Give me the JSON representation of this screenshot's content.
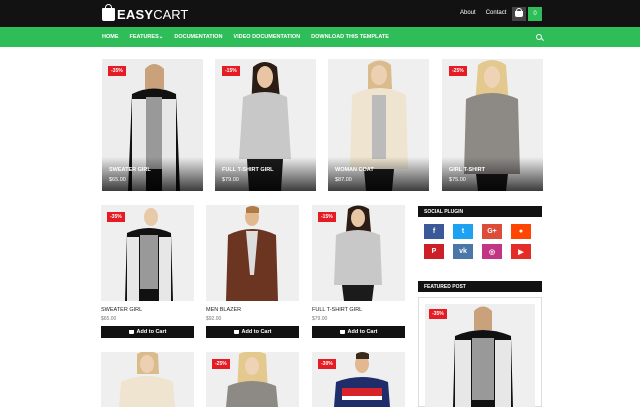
{
  "header": {
    "logo_bold": "EASY",
    "logo_rest": "CART",
    "links": [
      "About",
      "Contact"
    ],
    "cart_count": "0"
  },
  "nav": {
    "items": [
      "HOME",
      "FEATURES",
      "DOCUMENTATION",
      "VIDEO DOCUMENTATION",
      "DOWNLOAD THIS TEMPLATE"
    ],
    "features_caret": "⌄"
  },
  "featured": [
    {
      "name": "SWEATER GIRL",
      "price": "$65.00",
      "badge": "-35%"
    },
    {
      "name": "FULL T-SHIRT GIRL",
      "price": "$79.00",
      "badge": "-15%"
    },
    {
      "name": "WOMAN COAT",
      "price": "$87.00",
      "badge": ""
    },
    {
      "name": "GIRL T-SHIRT",
      "price": "$75.00",
      "badge": "-25%"
    }
  ],
  "products": [
    {
      "name": "SWEATER GIRL",
      "price": "$65.00",
      "badge": "-35%"
    },
    {
      "name": "MEN BLAZER",
      "price": "$92.00",
      "badge": ""
    },
    {
      "name": "FULL T-SHIRT GIRL",
      "price": "$79.00",
      "badge": "-15%"
    }
  ],
  "bottom_row_badges": [
    "",
    "-25%",
    "-30%"
  ],
  "add_to_cart_label": "Add to Cart",
  "sidebar": {
    "social_title": "SOCIAL PLUGIN",
    "featured_title": "FEATURED POST",
    "featured_badge": "-35%",
    "social": [
      {
        "name": "facebook",
        "glyph": "f",
        "color": "#3b5998"
      },
      {
        "name": "twitter",
        "glyph": "t",
        "color": "#1da1f2"
      },
      {
        "name": "google-plus",
        "glyph": "G+",
        "color": "#dd4b39"
      },
      {
        "name": "reddit",
        "glyph": "●",
        "color": "#ff4500"
      },
      {
        "name": "pinterest",
        "glyph": "P",
        "color": "#cb2027"
      },
      {
        "name": "vk",
        "glyph": "vk",
        "color": "#4a76a8"
      },
      {
        "name": "instagram",
        "glyph": "◎",
        "color": "#c13584"
      },
      {
        "name": "youtube",
        "glyph": "▶",
        "color": "#e52d27"
      }
    ]
  },
  "colors": {
    "accent_green": "#2ebd59",
    "badge_red": "#e51c23",
    "dark": "#121212"
  }
}
